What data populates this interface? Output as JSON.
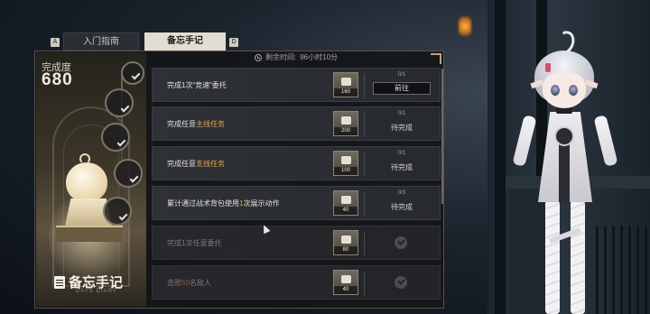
{
  "tabs": {
    "prev_key": "A",
    "next_key": "D",
    "items": [
      {
        "label": "入门指南",
        "active": false
      },
      {
        "label": "备忘手记",
        "active": true
      }
    ]
  },
  "timer": {
    "label": "剩余时间:",
    "value": "96小时10分"
  },
  "progress": {
    "label": "完成度",
    "value": "680"
  },
  "milestones": [
    "",
    "",
    "",
    "",
    ""
  ],
  "rows": [
    {
      "title_pre": "完成1次“竞速”委托",
      "title_hl": "",
      "title_post": "",
      "reward": "160",
      "progress": "0/1",
      "status": "前往",
      "state": "go"
    },
    {
      "title_pre": "完成任意",
      "title_hl": "主线任务",
      "title_post": "",
      "reward": "200",
      "progress": "0/1",
      "status": "待完成",
      "state": "pending"
    },
    {
      "title_pre": "完成任意",
      "title_hl": "支线任务",
      "title_post": "",
      "reward": "100",
      "progress": "0/1",
      "status": "待完成",
      "state": "pending"
    },
    {
      "title_pre": "累计通过战术背包使用",
      "title_hl": "1",
      "title_post": "次展示动作",
      "reward": "40",
      "progress": "0/3",
      "status": "待完成",
      "state": "pending"
    },
    {
      "title_pre": "完成1次任意委托",
      "title_hl": "",
      "title_post": "",
      "reward": "80",
      "progress": "",
      "status": "",
      "state": "done"
    },
    {
      "title_pre": "击败",
      "title_hl": "50",
      "title_post": "名敌人",
      "reward": "40",
      "progress": "",
      "status": "",
      "state": "done"
    }
  ],
  "footer": {
    "title": "备忘手记",
    "subtitle": "DAYS DIARY"
  },
  "colors": {
    "accent": "#e8a33a",
    "panel": "#141619",
    "border": "#5b5446"
  }
}
